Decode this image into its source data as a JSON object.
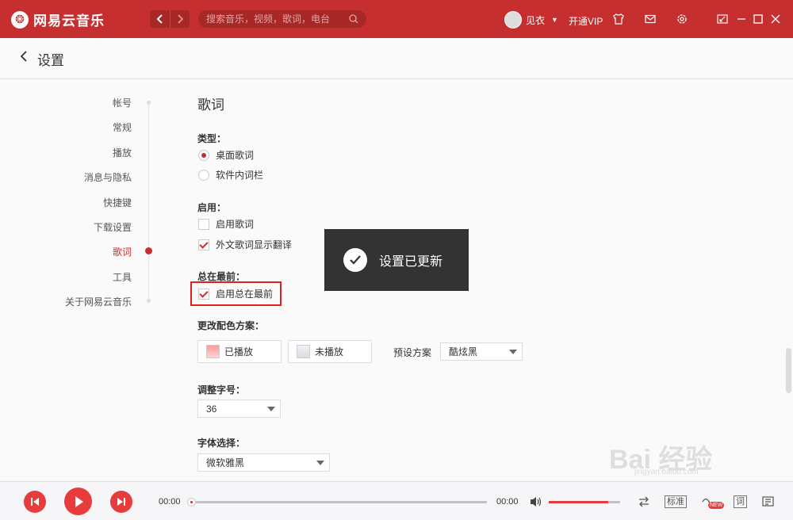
{
  "app": {
    "name": "网易云音乐",
    "logo_glyph": "❂"
  },
  "titlebar": {
    "search_placeholder": "搜索音乐，视频，歌词，电台",
    "username": "见衣",
    "vip_label": "开通VIP",
    "accent": "#c62f2f"
  },
  "header": {
    "back_glyph": "‹",
    "title": "设置"
  },
  "sidenav": {
    "items": [
      "帐号",
      "常规",
      "播放",
      "消息与隐私",
      "快捷键",
      "下载设置",
      "歌词",
      "工具",
      "关于网易云音乐"
    ],
    "active": "歌词"
  },
  "lyrics": {
    "title": "歌词",
    "type_label": "类型：",
    "type_options": [
      "桌面歌词",
      "软件内词栏"
    ],
    "selected_type": "桌面歌词",
    "enable_label": "启用：",
    "enable_lyrics": "启用歌词",
    "enable_lyrics_checked": false,
    "show_translation": "外文歌词显示翻译",
    "show_translation_checked": true,
    "always_top_label": "总在最前：",
    "always_top_option": "启用总在最前",
    "always_top_checked": true,
    "color_label": "更改配色方案：",
    "played_label": "已播放",
    "unplayed_label": "未播放",
    "preset_label": "预设方案",
    "preset_value": "酷炫黑",
    "font_size_label": "调整字号：",
    "font_size_value": "36",
    "font_label": "字体选择：",
    "font_value": "微软雅黑"
  },
  "toast": {
    "message": "设置已更新"
  },
  "player": {
    "current_time": "00:00",
    "total_time": "00:00",
    "progress": 0,
    "volume": 0.83,
    "quality_label": "标准",
    "lyrics_label": "词",
    "new_badge": "NEW"
  },
  "watermark": {
    "text": "Bai 经验",
    "sub": "jingyan.baidu.com"
  }
}
